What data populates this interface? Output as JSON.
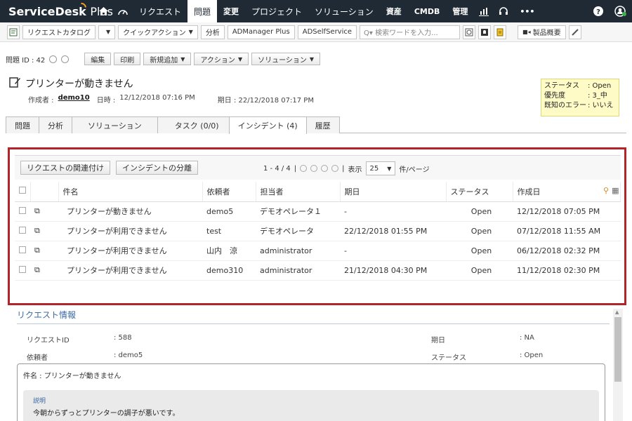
{
  "topnav": {
    "brand": "ServiceDesk",
    "brand_plus": "Plus",
    "items": [
      {
        "label": "リクエスト",
        "active": false
      },
      {
        "label": "問題",
        "active": true
      },
      {
        "label": "変更",
        "active": false
      },
      {
        "label": "プロジェクト",
        "active": false
      },
      {
        "label": "ソリューション",
        "active": false
      },
      {
        "label": "資産",
        "active": false
      },
      {
        "label": "CMDB",
        "active": false
      },
      {
        "label": "管理",
        "active": false
      }
    ],
    "more": "•••"
  },
  "toolbar": {
    "request_catalog": "リクエストカタログ",
    "quick_action": "クイックアクション",
    "analysis": "分析",
    "admanager": "ADManager Plus",
    "adselfservice": "ADSelfService",
    "search_placeholder": "Q▾ 検索ワードを入力...",
    "product_overview": "製品概要"
  },
  "problem": {
    "id_label": "問題 ID : 42",
    "edit": "編集",
    "print": "印刷",
    "new_add": "新規追加",
    "action": "アクション",
    "solution": "ソリューション",
    "title": "プリンターが動きません",
    "created_by_label": "作成者 :",
    "created_by": "demo10",
    "datetime_label": "日時 :",
    "datetime": "12/12/2018 07:16 PM",
    "due": "期日 : 22/12/2018 07:17 PM"
  },
  "status_box": {
    "rows": [
      {
        "k": "ステータス",
        "v": ": Open"
      },
      {
        "k": "優先度",
        "v": ": 3_中"
      },
      {
        "k": "既知のエラー",
        "v": ": いいえ"
      }
    ]
  },
  "tabs": [
    "問題",
    "分析",
    "ソリューション",
    "タスク (0/0)",
    "インシデント (4)",
    "履歴"
  ],
  "incident": {
    "link_request": "リクエストの関連付け",
    "split_incident": "インシデントの分離",
    "page_range": "1 - 4 / 4",
    "display_label": "表示",
    "per_page": "25",
    "per_page_suffix": "件/ページ",
    "columns": [
      "件名",
      "依頼者",
      "担当者",
      "期日",
      "ステータス",
      "作成日"
    ],
    "rows": [
      {
        "subject": "プリンターが動きません",
        "requester": "demo5",
        "technician": "デモオペレータ１",
        "due": "-",
        "status": "Open",
        "created": "12/12/2018 07:05 PM"
      },
      {
        "subject": "プリンターが利用できません",
        "requester": "test",
        "technician": "デモオペレータ",
        "due": "22/12/2018 01:55 PM",
        "status": "Open",
        "created": "07/12/2018 11:55 AM"
      },
      {
        "subject": "プリンターが利用できません",
        "requester": "山内　涼",
        "technician": "administrator",
        "due": "-",
        "status": "Open",
        "created": "06/12/2018 02:32 PM"
      },
      {
        "subject": "プリンターが利用できません",
        "requester": "demo310",
        "technician": "administrator",
        "due": "21/12/2018 04:30 PM",
        "status": "Open",
        "created": "11/12/2018 02:30 PM"
      }
    ]
  },
  "request_info": {
    "title": "リクエスト情報",
    "id_label": "リクエストID",
    "id_value": ": 588",
    "requester_label": "依頼者",
    "requester_value": ": demo5",
    "due_label": "期日",
    "due_value": ": NA",
    "status_label": "ステータス",
    "status_value": ": Open",
    "subject_line": "件名 : プリンターが動きません",
    "desc_label": "説明",
    "desc_text": "今朝からずっとプリンターの調子が悪いです。"
  }
}
